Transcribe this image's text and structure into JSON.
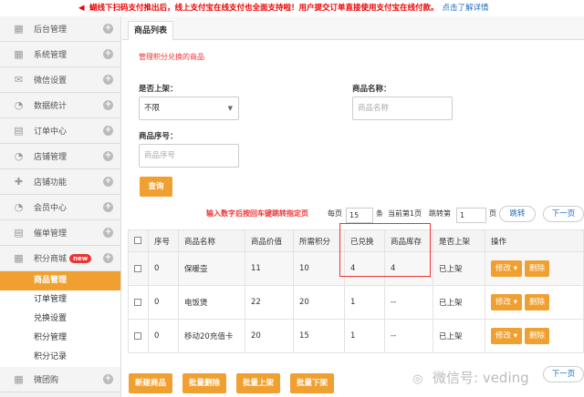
{
  "notice": {
    "text": "蝴线下扫码支付推出后，线上支付宝在线支付也全面支持啦！用户提交订单直接使用支付宝在线付款。",
    "link": "点击了解详情"
  },
  "sidebar": {
    "items": [
      {
        "label": "后台管理",
        "icon": "grid-icon"
      },
      {
        "label": "系统管理",
        "icon": "grid-icon"
      },
      {
        "label": "微信设置",
        "icon": "mail-icon"
      },
      {
        "label": "数据统计",
        "icon": "pie-icon"
      },
      {
        "label": "订单中心",
        "icon": "printer-icon"
      },
      {
        "label": "店铺管理",
        "icon": "pie-icon"
      },
      {
        "label": "店铺功能",
        "icon": "plus-icon"
      },
      {
        "label": "会员中心",
        "icon": "pie-icon"
      },
      {
        "label": "催单管理",
        "icon": "printer-icon"
      },
      {
        "label": "积分商城",
        "icon": "grid-icon",
        "badge": "new"
      }
    ],
    "subitems": [
      "商品管理",
      "订单管理",
      "兑换设置",
      "积分管理",
      "积分记录"
    ],
    "last_item": {
      "label": "微团购",
      "icon": "grid-icon"
    }
  },
  "tab": "商品列表",
  "subtitle": "管理积分兑换的商品",
  "filters": {
    "onshelf_label": "是否上架：",
    "onshelf_value": "不限",
    "name_label": "商品名称：",
    "name_placeholder": "商品名称",
    "serial_label": "商品序号：",
    "serial_placeholder": "商品序号",
    "search_button": "查询"
  },
  "pager": {
    "hint": "输入数字后按回车键跳转指定页",
    "per_page_label": "每页",
    "per_page_value": "15",
    "unit": "条",
    "current": "当前第1页",
    "jump_label": "跳转第",
    "jump_value": "1",
    "page_unit": "页",
    "jump_button": "跳转",
    "next_button": "下一页"
  },
  "table": {
    "headers": [
      "序号",
      "商品名称",
      "商品价值",
      "所需积分",
      "已兑换",
      "商品库存",
      "是否上架",
      "操作"
    ],
    "rows": [
      {
        "idx": "0",
        "name": "保暖壶",
        "value": "11",
        "points": "10",
        "redeemed": "4",
        "stock": "4",
        "onshelf": "已上架"
      },
      {
        "idx": "0",
        "name": "电饭煲",
        "value": "22",
        "points": "20",
        "redeemed": "1",
        "stock": "--",
        "onshelf": "已上架"
      },
      {
        "idx": "0",
        "name": "移动20充值卡",
        "value": "20",
        "points": "15",
        "redeemed": "1",
        "stock": "--",
        "onshelf": "已上架"
      }
    ],
    "edit_label": "修改",
    "delete_label": "删除"
  },
  "bottom_buttons": [
    "新建商品",
    "批量删除",
    "批量上架",
    "批量下架"
  ],
  "bottom_next": "下一页",
  "watermark": "微信号: veding",
  "colors": {
    "accent": "#f0a030",
    "alert": "#e33333",
    "link": "#1e6fbf"
  }
}
